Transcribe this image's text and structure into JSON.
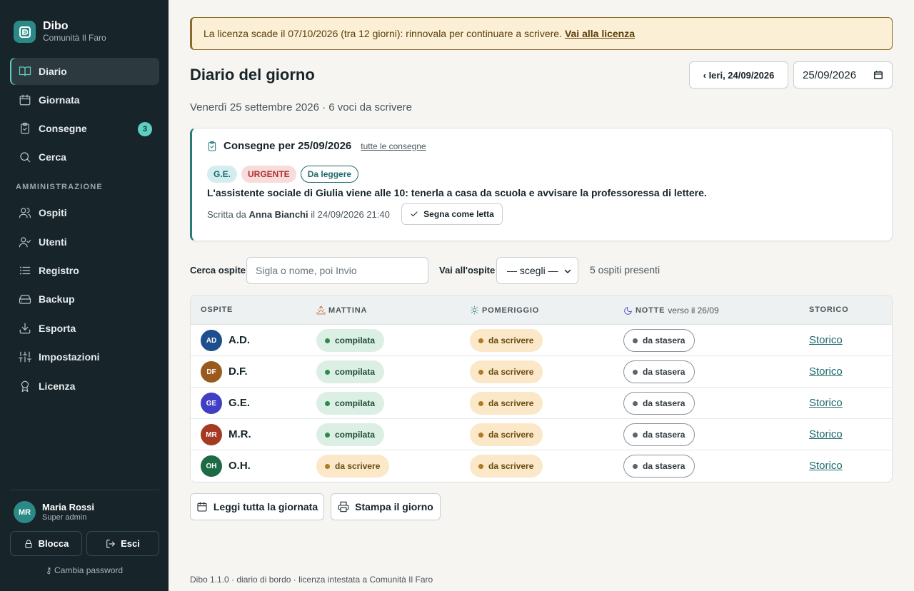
{
  "brand": {
    "name": "Dibo",
    "community": "Comunità Il Faro"
  },
  "nav": {
    "items": [
      {
        "label": "Diario",
        "icon": "book-icon",
        "active": true
      },
      {
        "label": "Giornata",
        "icon": "calendar-icon"
      },
      {
        "label": "Consegne",
        "icon": "clipboard-icon",
        "badge": "3"
      },
      {
        "label": "Cerca",
        "icon": "search-icon"
      }
    ],
    "section_label": "AMMINISTRAZIONE",
    "admin_items": [
      {
        "label": "Ospiti",
        "icon": "users-icon"
      },
      {
        "label": "Utenti",
        "icon": "user-check-icon"
      },
      {
        "label": "Registro",
        "icon": "list-icon"
      },
      {
        "label": "Backup",
        "icon": "hard-drive-icon"
      },
      {
        "label": "Esporta",
        "icon": "download-icon"
      },
      {
        "label": "Impostazioni",
        "icon": "sliders-icon"
      },
      {
        "label": "Licenza",
        "icon": "award-icon"
      }
    ]
  },
  "user": {
    "initials": "MR",
    "name": "Maria Rossi",
    "role": "Super admin"
  },
  "sidebar_actions": {
    "lock": "Blocca",
    "exit": "Esci",
    "change_password": "Cambia password"
  },
  "banner": {
    "text": "La licenza scade il 07/10/2026 (tra 12 giorni): rinnovala per continuare a scrivere.",
    "link": "Vai alla licenza"
  },
  "page": {
    "title": "Diario del giorno",
    "subtitle": "Venerdì 25 settembre 2026 · 6 voci da scrivere",
    "prev_day": "‹ Ieri, 24/09/2026",
    "date_value": "25/09/2026"
  },
  "handover": {
    "title": "Consegne per 25/09/2026",
    "all_link": "tutte le consegne",
    "tags": [
      "G.E.",
      "URGENTE",
      "Da leggere"
    ],
    "text": "L'assistente sociale di Giulia viene alle 10: tenerla a casa da scuola e avvisare la professoressa di lettere.",
    "meta_prefix": "Scritta da",
    "author": "Anna Bianchi",
    "meta_suffix": "il 24/09/2026 21:40",
    "mark_read": "Segna come letta"
  },
  "filters": {
    "search_label": "Cerca ospite",
    "search_placeholder": "Sigla o nome, poi Invio",
    "goto_label": "Vai all'ospite",
    "goto_value": "— scegli —",
    "present": "5 ospiti presenti"
  },
  "table": {
    "headers": {
      "guest": "OSPITE",
      "morning": "MATTINA",
      "afternoon": "POMERIGGIO",
      "night": "NOTTE",
      "night_note": "verso il 26/09",
      "history": "STORICO"
    },
    "rows": [
      {
        "initials": "AD",
        "sigla": "A.D.",
        "color": "#1f4e8c",
        "morning": "compilata",
        "morning_state": "done",
        "afternoon": "da scrivere",
        "night": "da stasera",
        "history": "Storico"
      },
      {
        "initials": "DF",
        "sigla": "D.F.",
        "color": "#9a5a1e",
        "morning": "compilata",
        "morning_state": "done",
        "afternoon": "da scrivere",
        "night": "da stasera",
        "history": "Storico"
      },
      {
        "initials": "GE",
        "sigla": "G.E.",
        "color": "#3f3ec4",
        "morning": "compilata",
        "morning_state": "done",
        "afternoon": "da scrivere",
        "night": "da stasera",
        "history": "Storico"
      },
      {
        "initials": "MR",
        "sigla": "M.R.",
        "color": "#a53a22",
        "morning": "compilata",
        "morning_state": "done",
        "afternoon": "da scrivere",
        "night": "da stasera",
        "history": "Storico"
      },
      {
        "initials": "OH",
        "sigla": "O.H.",
        "color": "#1d6b45",
        "morning": "da scrivere",
        "morning_state": "todo",
        "afternoon": "da scrivere",
        "night": "da stasera",
        "history": "Storico"
      }
    ]
  },
  "actions": {
    "read_all": "Leggi tutta la giornata",
    "print": "Stampa il giorno"
  },
  "footer": "Dibo 1.1.0 · diario di bordo · licenza intestata a Comunità Il Faro",
  "colors": {
    "accent": "#5ecec2",
    "sidebar": "#17242a",
    "teal": "#2b7a78"
  }
}
